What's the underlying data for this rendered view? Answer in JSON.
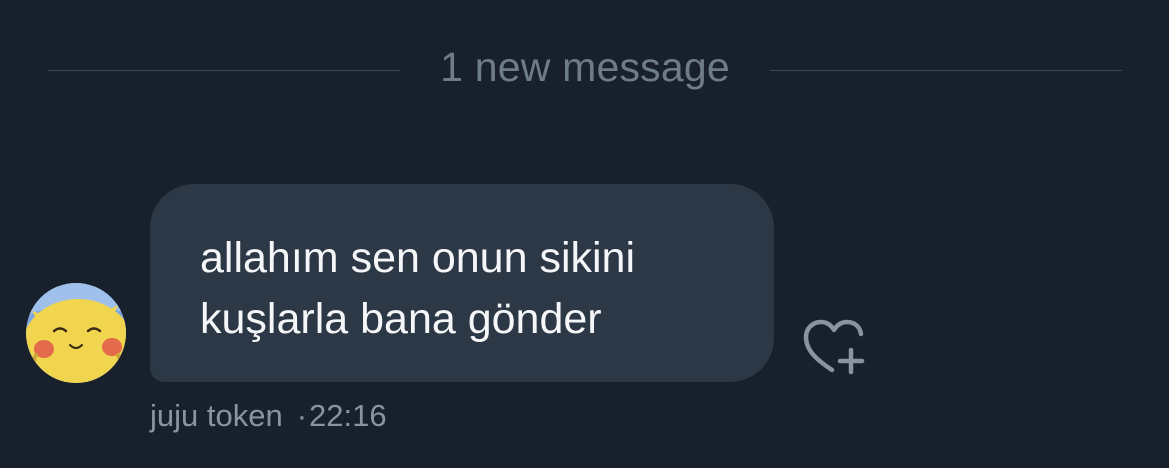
{
  "divider": {
    "label": "1 new message"
  },
  "message": {
    "text": "allahım sen onun sikini\nkuşlarla bana gönder",
    "sender": "juju token",
    "separator": "·",
    "time": "22:16",
    "avatar_icon": "pikachu-avatar"
  },
  "actions": {
    "react_icon": "heart-plus-icon"
  },
  "colors": {
    "background": "#17202b",
    "bubble": "#2c3846",
    "text_primary": "#f4f6f8",
    "text_secondary": "#8894a1",
    "divider": "#3a4653"
  }
}
